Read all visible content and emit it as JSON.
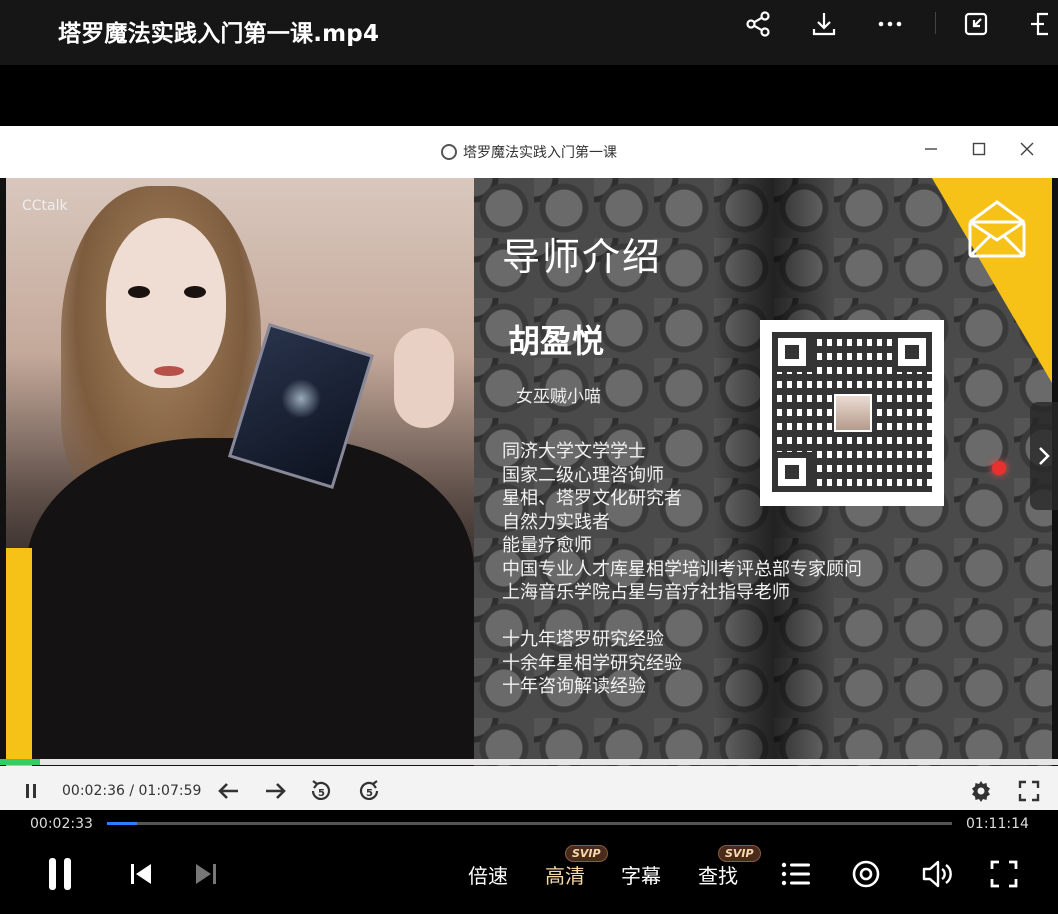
{
  "app": {
    "title": "塔罗魔法实践入门第一课.mp4"
  },
  "inner_window": {
    "title": "塔罗魔法实践入门第一课"
  },
  "slide": {
    "watermark": "CCtalk",
    "heading": "导师介绍",
    "name": "胡盈悦",
    "alias": "女巫贼小喵",
    "credentials": [
      "同济大学文学学士",
      "国家二级心理咨询师",
      "星相、塔罗文化研究者",
      "自然力实践者",
      "能量疗愈师",
      "中国专业人才库星相学培训考评总部专家顾问",
      "上海音乐学院占星与音疗社指导老师"
    ],
    "experience": [
      "十九年塔罗研究经验",
      "十余年星相学研究经验",
      "十年咨询解读经验"
    ],
    "accent_color": "#f6c217"
  },
  "inner_player": {
    "current_time": "00:02:36",
    "separator": "/",
    "total_time": "01:07:59",
    "progress_fraction": 0.038
  },
  "outer_player": {
    "current_time": "00:02:33",
    "total_time": "01:11:14",
    "progress_fraction": 0.036,
    "accent_color": "#2e7fff",
    "speed_label": "倍速",
    "quality_label": "高清",
    "subtitle_label": "字幕",
    "search_label": "查找",
    "svip_badge": "SVIP"
  }
}
